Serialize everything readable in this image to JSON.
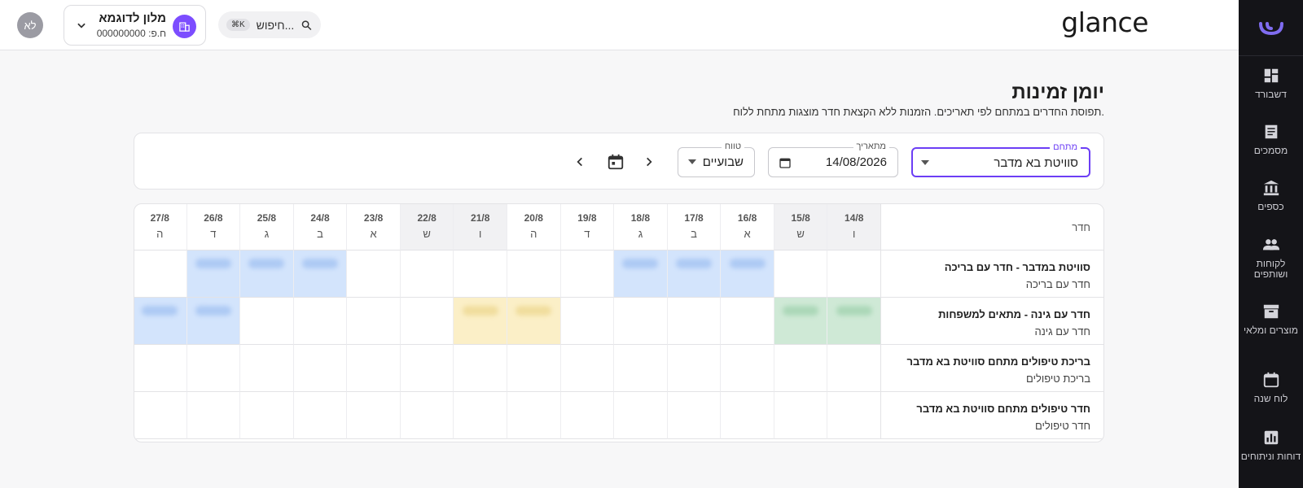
{
  "app": {
    "brand": "glance"
  },
  "sidebar": {
    "items": [
      {
        "label": "דשבורד",
        "icon": "dashboard-icon"
      },
      {
        "label": "מסמכים",
        "icon": "document-icon"
      },
      {
        "label": "כספים",
        "icon": "bank-icon"
      },
      {
        "label": "לקוחות ושותפים",
        "icon": "people-icon"
      },
      {
        "label": "מוצרים ומלאי",
        "icon": "archive-icon"
      },
      {
        "label": "לוח שנה",
        "icon": "calendar-icon"
      },
      {
        "label": "דוחות וניתוחים",
        "icon": "chart-icon"
      }
    ]
  },
  "header": {
    "search_placeholder": "חיפוש...",
    "search_shortcut": "⌘K",
    "hotel_name": "מלון לדוגמא",
    "hotel_id": "ח.פ: 000000000",
    "avatar_initials": "לא"
  },
  "page": {
    "title": "יומן זמינות",
    "subtitle": "תפוסת החדרים במתחם לפי תאריכים. הזמנות ללא הקצאת חדר מוצגות מתחת ללוח."
  },
  "filters": {
    "complex_label": "מתחם",
    "complex_value": "סוויטת בא מדבר",
    "from_label": "מתאריך",
    "from_value": "14/08/2026",
    "range_label": "טווח",
    "range_value": "שבועיים"
  },
  "grid": {
    "room_header": "חדר",
    "days": [
      {
        "date": "14/8",
        "dow": "ו",
        "weekend": true
      },
      {
        "date": "15/8",
        "dow": "ש",
        "weekend": true
      },
      {
        "date": "16/8",
        "dow": "א",
        "weekend": false
      },
      {
        "date": "17/8",
        "dow": "ב",
        "weekend": false
      },
      {
        "date": "18/8",
        "dow": "ג",
        "weekend": false
      },
      {
        "date": "19/8",
        "dow": "ד",
        "weekend": false
      },
      {
        "date": "20/8",
        "dow": "ה",
        "weekend": false
      },
      {
        "date": "21/8",
        "dow": "ו",
        "weekend": true
      },
      {
        "date": "22/8",
        "dow": "ש",
        "weekend": true
      },
      {
        "date": "23/8",
        "dow": "א",
        "weekend": false
      },
      {
        "date": "24/8",
        "dow": "ב",
        "weekend": false
      },
      {
        "date": "25/8",
        "dow": "ג",
        "weekend": false
      },
      {
        "date": "26/8",
        "dow": "ד",
        "weekend": false
      },
      {
        "date": "27/8",
        "dow": "ה",
        "weekend": false
      }
    ],
    "rooms": [
      {
        "name": "סוויטת במדבר - חדר עם בריכה",
        "type": "חדר עם בריכה",
        "bookings": [
          "",
          "",
          "blue",
          "blue",
          "blue",
          "",
          "",
          "",
          "",
          "",
          "blue",
          "blue",
          "blue",
          ""
        ]
      },
      {
        "name": "חדר עם גינה - מתאים למשפחות",
        "type": "חדר עם גינה",
        "bookings": [
          "green",
          "green",
          "",
          "",
          "",
          "",
          "yellow",
          "yellow",
          "",
          "",
          "",
          "",
          "blue",
          "blue"
        ]
      },
      {
        "name": "בריכת טיפולים מתחם סוויטת בא מדבר",
        "type": "בריכת טיפולים",
        "bookings": [
          "",
          "",
          "",
          "",
          "",
          "",
          "",
          "",
          "",
          "",
          "",
          "",
          "",
          ""
        ]
      },
      {
        "name": "חדר טיפולים מתחם סוויטת בא מדבר",
        "type": "חדר טיפולים",
        "bookings": [
          "",
          "",
          "",
          "",
          "",
          "",
          "",
          "",
          "",
          "",
          "",
          "",
          "",
          ""
        ]
      }
    ]
  },
  "colors": {
    "accent": "#6c3ef5",
    "booking_blue": "#d3e4fc",
    "booking_green": "#cfe9d6",
    "booking_yellow": "#fbefc7"
  }
}
